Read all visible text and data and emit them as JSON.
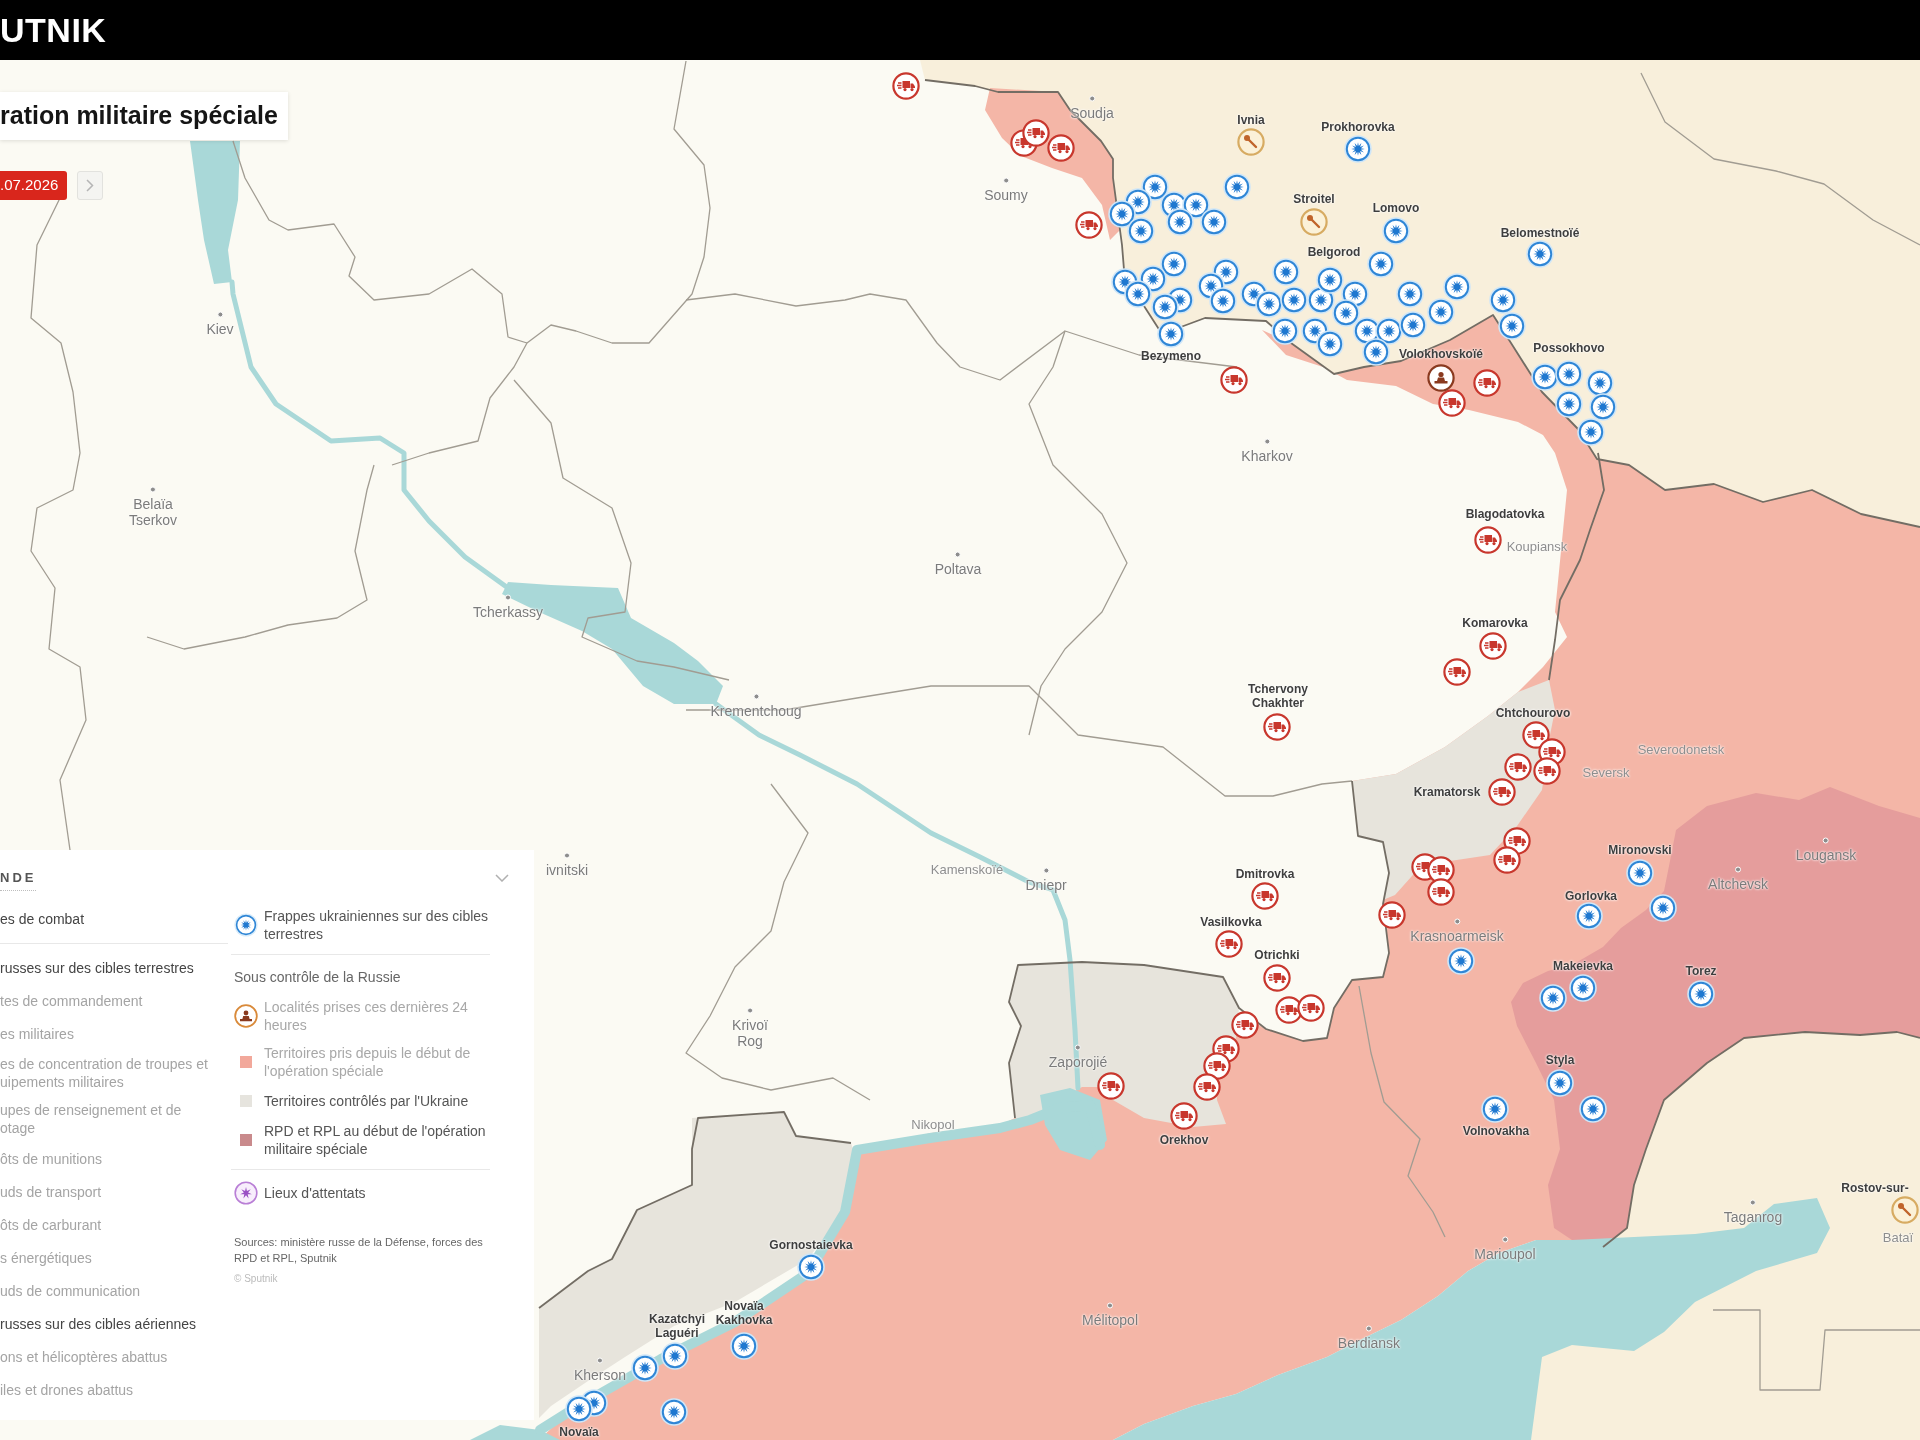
{
  "header": {
    "logo": "UTNIK"
  },
  "title": "ration militaire spéciale",
  "date_nav": {
    "date": ".07.2026"
  },
  "map": {
    "places": [
      {
        "name": "Soudja",
        "kind": "city"
      },
      {
        "name": "Ivnia",
        "kind": "town"
      },
      {
        "name": "Prokhorovka",
        "kind": "town"
      },
      {
        "name": "Soumy",
        "kind": "city"
      },
      {
        "name": "Stroitel",
        "kind": "town"
      },
      {
        "name": "Lomovo",
        "kind": "town"
      },
      {
        "name": "Belomestnoïé",
        "kind": "town"
      },
      {
        "name": "Belgorod",
        "kind": "town"
      },
      {
        "name": "Kiev",
        "kind": "city"
      },
      {
        "name": "Bezymeno",
        "kind": "town"
      },
      {
        "name": "Volokhovskoïé",
        "kind": "town"
      },
      {
        "name": "Possokhovo",
        "kind": "town"
      },
      {
        "name": "Kharkov",
        "kind": "city"
      },
      {
        "name": "Belaïa Tserkov",
        "kind": "city"
      },
      {
        "name": "Blagodatovka",
        "kind": "town"
      },
      {
        "name": "Koupiansk",
        "kind": "minor"
      },
      {
        "name": "Poltava",
        "kind": "city"
      },
      {
        "name": "Tcherkassy",
        "kind": "city"
      },
      {
        "name": "Komarovka",
        "kind": "town"
      },
      {
        "name": "Tchervony Chakhter",
        "kind": "town"
      },
      {
        "name": "Krementchoug",
        "kind": "city"
      },
      {
        "name": "Chtchourovo",
        "kind": "town"
      },
      {
        "name": "Severodonetsk",
        "kind": "minor"
      },
      {
        "name": "Seversk",
        "kind": "minor"
      },
      {
        "name": "Kramatorsk",
        "kind": "town"
      },
      {
        "name": "Mironovski",
        "kind": "town"
      },
      {
        "name": "Lougansk",
        "kind": "city"
      },
      {
        "name": "ivnitski",
        "kind": "city"
      },
      {
        "name": "Kamenskoïé",
        "kind": "minor"
      },
      {
        "name": "Dniepr",
        "kind": "city"
      },
      {
        "name": "Dmitrovka",
        "kind": "town"
      },
      {
        "name": "Altchevsk",
        "kind": "city"
      },
      {
        "name": "Gorlovka",
        "kind": "town"
      },
      {
        "name": "Vasilkovka",
        "kind": "town"
      },
      {
        "name": "Krasnoarmeisk",
        "kind": "city"
      },
      {
        "name": "Otrichki",
        "kind": "town"
      },
      {
        "name": "Makeievka",
        "kind": "town"
      },
      {
        "name": "Torez",
        "kind": "town"
      },
      {
        "name": "Krivoï Rog",
        "kind": "city"
      },
      {
        "name": "Zaporojié",
        "kind": "city"
      },
      {
        "name": "Styla",
        "kind": "town"
      },
      {
        "name": "Nikopol",
        "kind": "minor"
      },
      {
        "name": "Orekhov",
        "kind": "town"
      },
      {
        "name": "Volnovakha",
        "kind": "town"
      },
      {
        "name": "Rostov-sur-",
        "kind": "town"
      },
      {
        "name": "Taganrog",
        "kind": "city"
      },
      {
        "name": "Bataï",
        "kind": "minor"
      },
      {
        "name": "Gornostaievka",
        "kind": "town"
      },
      {
        "name": "Marioupol",
        "kind": "city"
      },
      {
        "name": "Kazatchyi Laguéri",
        "kind": "town"
      },
      {
        "name": "Novaïa Kakhovka",
        "kind": "town"
      },
      {
        "name": "Mélitopol",
        "kind": "city"
      },
      {
        "name": "Berdiansk",
        "kind": "city"
      },
      {
        "name": "Kherson",
        "kind": "city"
      },
      {
        "name": "Novaïa",
        "kind": "town"
      }
    ]
  },
  "legend": {
    "title": "NDE",
    "expanded": true,
    "left": [
      {
        "kind": "heading",
        "label": "es de combat",
        "active": true
      },
      {
        "kind": "heading",
        "label": "russes sur des cibles terrestres",
        "active": true
      },
      {
        "kind": "item",
        "label": "tes de commandement",
        "active": false
      },
      {
        "kind": "item",
        "label": "es militaires",
        "active": false
      },
      {
        "kind": "item",
        "label": "es de concentration de troupes et\nuipements militaires",
        "active": false
      },
      {
        "kind": "item",
        "label": "upes de renseignement et de\notage",
        "active": false
      },
      {
        "kind": "item",
        "label": "ôts de munitions",
        "active": false
      },
      {
        "kind": "item",
        "label": "uds de transport",
        "active": false
      },
      {
        "kind": "item",
        "label": "ôts de carburant",
        "active": false
      },
      {
        "kind": "item",
        "label": "s énergétiques",
        "active": false
      },
      {
        "kind": "item",
        "label": "uds de communication",
        "active": false
      },
      {
        "kind": "heading",
        "label": "russes sur des cibles aériennes",
        "active": true
      },
      {
        "kind": "item",
        "label": "ons et hélicoptères abattus",
        "active": false
      },
      {
        "kind": "item",
        "label": "iles et drones abattus",
        "active": false
      }
    ],
    "right": [
      {
        "kind": "strike",
        "label": "Frappes ukrainiennes sur des cibles terrestres",
        "active": true
      },
      {
        "kind": "heading",
        "label": "Sous contrôle de la Russie"
      },
      {
        "kind": "locality",
        "label": "Localités prises ces dernières 24 heures",
        "active": false
      },
      {
        "kind": "swatch",
        "label": "Territoires pris depuis le début de l'opération spéciale",
        "color": "#f2a89b",
        "active": false
      },
      {
        "kind": "swatch",
        "label": "Territoires contrôlés par l'Ukraine",
        "color": "#e6e4de",
        "active": true
      },
      {
        "kind": "swatch",
        "label": "RPD et RPL au début de l'opération militaire spéciale",
        "color": "#c98a8c",
        "active": true
      },
      {
        "kind": "attack",
        "label": "Lieux d'attentats",
        "active": true
      }
    ],
    "sources": "Sources: ministère russe de la Défense, forces des RPD et RPL, Sputnik",
    "copyright": "© Sputnik"
  }
}
